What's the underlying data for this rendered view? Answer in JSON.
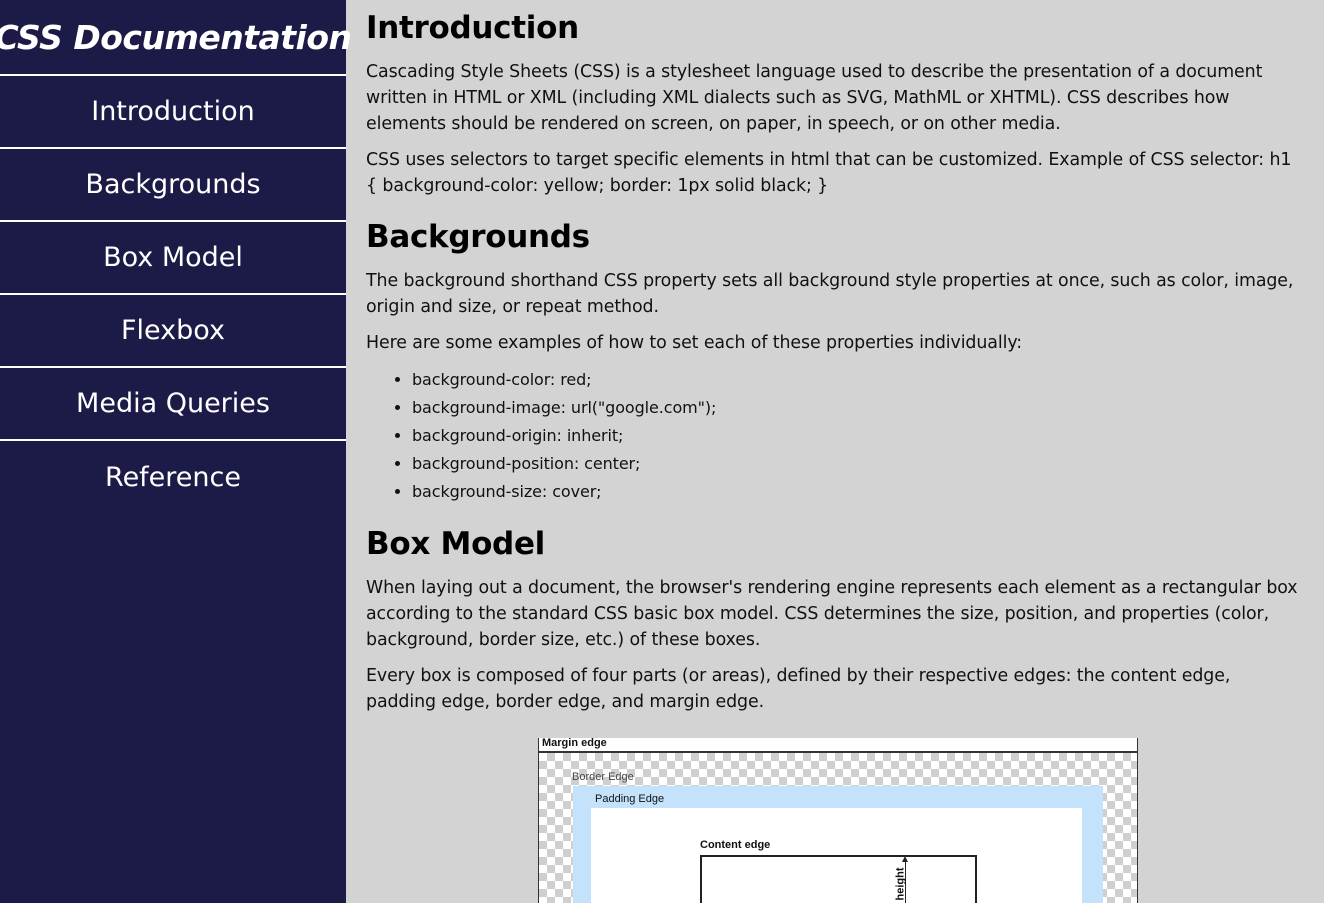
{
  "navbar": {
    "title": "CSS Documentation",
    "links": [
      "Introduction",
      "Backgrounds",
      "Box Model",
      "Flexbox",
      "Media Queries",
      "Reference"
    ]
  },
  "sections": {
    "introduction": {
      "heading": "Introduction",
      "paragraphs": [
        "Cascading Style Sheets (CSS) is a stylesheet language used to describe the presentation of a document written in HTML or XML (including XML dialects such as SVG, MathML or XHTML). CSS describes how elements should be rendered on screen, on paper, in speech, or on other media.",
        "CSS uses selectors to target specific elements in html that can be customized. Example of CSS selector: h1 { background-color: yellow; border: 1px solid black; }"
      ]
    },
    "backgrounds": {
      "heading": "Backgrounds",
      "paragraphs": [
        "The background shorthand CSS property sets all background style properties at once, such as color, image, origin and size, or repeat method.",
        "Here are some examples of how to set each of these properties individually:"
      ],
      "list": [
        "background-color: red;",
        "background-image: url(\"google.com\");",
        "background-origin: inherit;",
        "background-position: center;",
        "background-size: cover;"
      ]
    },
    "box_model": {
      "heading": "Box Model",
      "paragraphs": [
        "When laying out a document, the browser's rendering engine represents each element as a rectangular box according to the standard CSS basic box model. CSS determines the size, position, and properties (color, background, border size, etc.) of these boxes.",
        "Every box is composed of four parts (or areas), defined by their respective edges: the content edge, padding edge, border edge, and margin edge."
      ],
      "figure": {
        "margin_label": "Margin edge",
        "border_label": "Border Edge",
        "padding_label": "Padding Edge",
        "content_label": "Content edge",
        "height_label": "height"
      }
    }
  },
  "colors": {
    "navbar_bg": "#1c1a46",
    "page_bg": "#d3d3d3",
    "padding_area": "#c5e2fd"
  }
}
